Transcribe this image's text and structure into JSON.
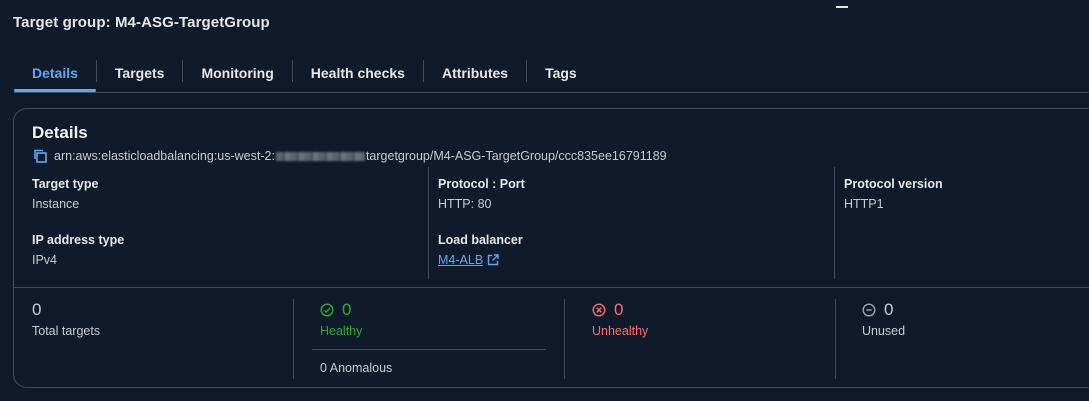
{
  "header": {
    "title": "Target group: M4-ASG-TargetGroup"
  },
  "tabs": [
    {
      "label": "Details",
      "active": true
    },
    {
      "label": "Targets"
    },
    {
      "label": "Monitoring"
    },
    {
      "label": "Health checks"
    },
    {
      "label": "Attributes"
    },
    {
      "label": "Tags"
    }
  ],
  "details": {
    "title": "Details",
    "arn_prefix": "arn:aws:elasticloadbalancing:us-west-2:",
    "arn_suffix": "targetgroup/M4-ASG-TargetGroup/ccc835ee16791189",
    "target_type_label": "Target type",
    "target_type_value": "Instance",
    "protocol_port_label": "Protocol : Port",
    "protocol_port_value": "HTTP: 80",
    "protocol_version_label": "Protocol version",
    "protocol_version_value": "HTTP1",
    "ip_address_type_label": "IP address type",
    "ip_address_type_value": "IPv4",
    "load_balancer_label": "Load balancer",
    "load_balancer_value": "M4-ALB"
  },
  "stats": {
    "total": {
      "value": "0",
      "label": "Total targets"
    },
    "healthy": {
      "value": "0",
      "label": "Healthy",
      "anomalous": "0 Anomalous"
    },
    "unhealthy": {
      "value": "0",
      "label": "Unhealthy"
    },
    "unused": {
      "value": "0",
      "label": "Unused"
    }
  },
  "colors": {
    "accent": "#5aa9f5",
    "healthy": "#29ad32",
    "unhealthy": "#ff6b6b",
    "background": "#0f1b2a",
    "border": "#414d5c"
  },
  "icons": {
    "copy": "copy-icon",
    "external_link": "external-link-icon",
    "healthy": "check-circle-icon",
    "unhealthy": "x-circle-icon",
    "unused": "minus-circle-icon"
  }
}
